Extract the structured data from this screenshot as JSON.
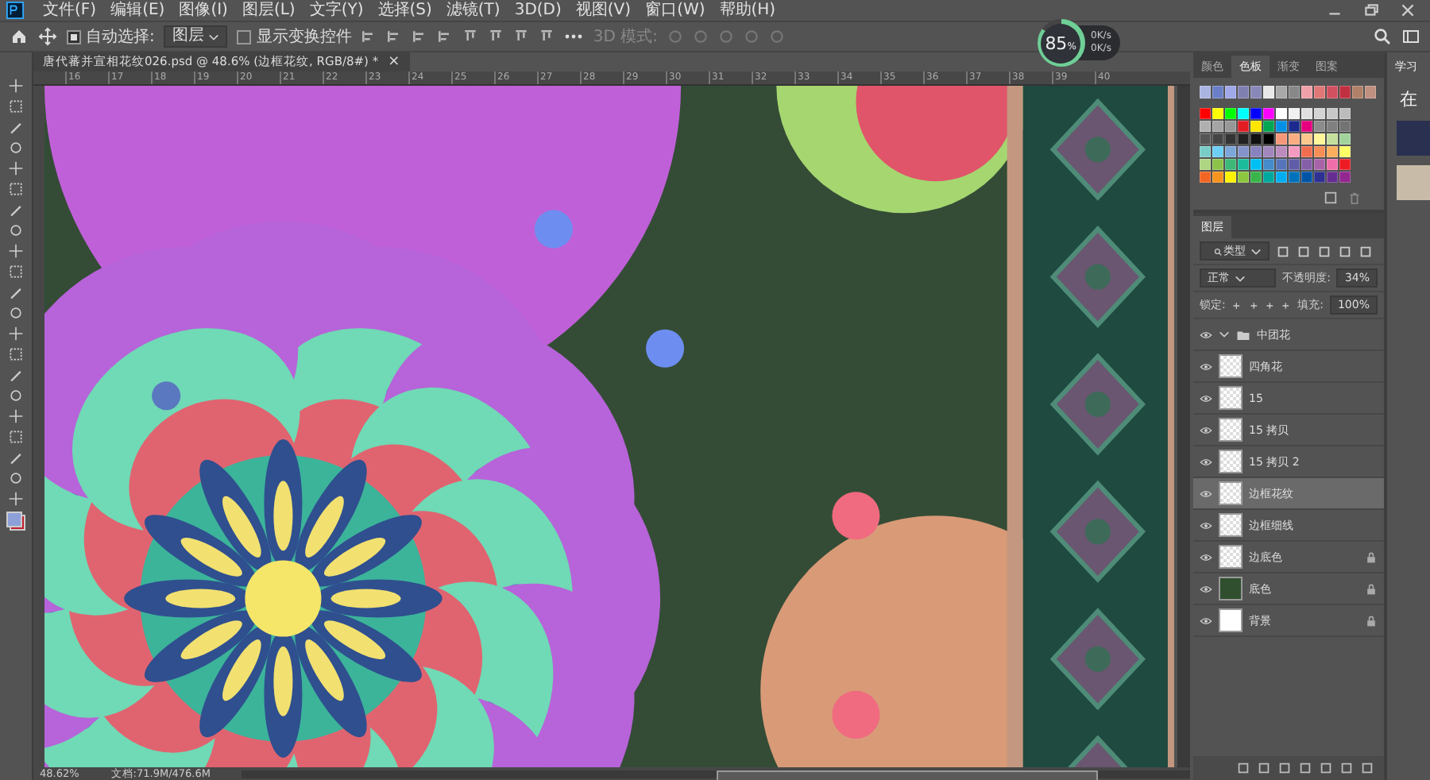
{
  "menu": [
    "文件(F)",
    "编辑(E)",
    "图像(I)",
    "图层(L)",
    "文字(Y)",
    "选择(S)",
    "滤镜(T)",
    "3D(D)",
    "视图(V)",
    "窗口(W)",
    "帮助(H)"
  ],
  "options": {
    "auto_select": {
      "label": "自动选择:",
      "checked": true
    },
    "target": "图层",
    "show_transform": {
      "label": "显示变换控件",
      "checked": false
    },
    "mode_3d": "3D 模式:"
  },
  "monitor": {
    "value": "85",
    "unit": "%",
    "up": "0K/s",
    "down": "0K/s",
    "level": 0.85
  },
  "document_tab": {
    "title": "唐代蕃并宣相花纹026.psd @ 48.6% (边框花纹, RGB/8#) *",
    "close": "×"
  },
  "ruler": [
    "16",
    "17",
    "18",
    "19",
    "20",
    "21",
    "22",
    "23",
    "24",
    "25",
    "26",
    "27",
    "28",
    "29",
    "30",
    "31",
    "32",
    "33",
    "34",
    "35",
    "36",
    "37",
    "38",
    "39",
    "40"
  ],
  "swatches_panel": {
    "tabs": [
      {
        "label": "颜色",
        "selected": false
      },
      {
        "label": "色板",
        "selected": true
      },
      {
        "label": "渐变",
        "selected": false
      },
      {
        "label": "图案",
        "selected": false
      }
    ],
    "recent": [
      {
        "color": "#aab4e0"
      },
      {
        "color": "#6b7fc8"
      },
      {
        "color": "#a0a8e8"
      },
      {
        "color": "#8080b0"
      },
      {
        "color": "#8888b8"
      },
      {
        "color": "#e8e8e8"
      },
      {
        "color": "#a8a8a8"
      },
      {
        "color": "#888888"
      },
      {
        "color": "#f0a0a8"
      },
      {
        "color": "#e07878"
      },
      {
        "color": "#d05060"
      },
      {
        "color": "#c03040"
      },
      {
        "color": "#b08068"
      },
      {
        "color": "#c09080"
      }
    ],
    "swatches": [
      {
        "color": "#ff0000"
      },
      {
        "color": "#ffff00"
      },
      {
        "color": "#00ff00"
      },
      {
        "color": "#00ffff"
      },
      {
        "color": "#0000ff"
      },
      {
        "color": "#ff00ff"
      },
      {
        "color": "#ffffff"
      },
      {
        "color": "#f0f0f0"
      },
      {
        "color": "#e0e0e0"
      },
      {
        "color": "#d4d4d4"
      },
      {
        "color": "#c8c8c8"
      },
      {
        "color": "#bcbcbc"
      },
      {
        "color": "#b0b0b0"
      },
      {
        "color": "#a4a4a4"
      },
      {
        "color": "#989898"
      },
      {
        "color": "#e31b23"
      },
      {
        "color": "#ffe600"
      },
      {
        "color": "#00a651"
      },
      {
        "color": "#0091e6"
      },
      {
        "color": "#1b2a8c"
      },
      {
        "color": "#e4007f"
      },
      {
        "color": "#8c8c8c"
      },
      {
        "color": "#808080"
      },
      {
        "color": "#737373"
      },
      {
        "color": "#555555"
      },
      {
        "color": "#444444"
      },
      {
        "color": "#333333"
      },
      {
        "color": "#222222"
      },
      {
        "color": "#111111"
      },
      {
        "color": "#000000"
      },
      {
        "color": "#f7977a"
      },
      {
        "color": "#fbad82"
      },
      {
        "color": "#fdc68c"
      },
      {
        "color": "#fff799"
      },
      {
        "color": "#c4df9b"
      },
      {
        "color": "#a3d39c"
      },
      {
        "color": "#7accc8"
      },
      {
        "color": "#6dcff6"
      },
      {
        "color": "#7da7d9"
      },
      {
        "color": "#8493ca"
      },
      {
        "color": "#8882be"
      },
      {
        "color": "#a187be"
      },
      {
        "color": "#bc8cbf"
      },
      {
        "color": "#f49ac1"
      },
      {
        "color": "#f26c4f"
      },
      {
        "color": "#f68e56"
      },
      {
        "color": "#fbaf5d"
      },
      {
        "color": "#ffff66"
      },
      {
        "color": "#aed581"
      },
      {
        "color": "#8bc34a"
      },
      {
        "color": "#3cb878"
      },
      {
        "color": "#1abc9c"
      },
      {
        "color": "#00bff3"
      },
      {
        "color": "#448ccb"
      },
      {
        "color": "#5674b9"
      },
      {
        "color": "#605ca8"
      },
      {
        "color": "#855fa8"
      },
      {
        "color": "#a863a8"
      },
      {
        "color": "#f06eaa"
      },
      {
        "color": "#ed1c24"
      },
      {
        "color": "#f26522"
      },
      {
        "color": "#f7941d"
      },
      {
        "color": "#fff200"
      },
      {
        "color": "#8dc63f"
      },
      {
        "color": "#39b54a"
      },
      {
        "color": "#00a99d"
      },
      {
        "color": "#00aeef"
      },
      {
        "color": "#0072bc"
      },
      {
        "color": "#0054a6"
      },
      {
        "color": "#2e3192"
      },
      {
        "color": "#662d91"
      },
      {
        "color": "#92278f"
      }
    ]
  },
  "learn_panel": {
    "tab": "学习",
    "text": "在"
  },
  "layers_panel": {
    "tab": "图层",
    "filter": "类型",
    "blend_mode": "正常",
    "opacity_label": "不透明度:",
    "opacity": "34%",
    "lock_label": "锁定:",
    "fill_label": "填充:",
    "fill": "100%",
    "layers": [
      {
        "kind": "group",
        "name": "中团花",
        "visible": true,
        "expanded": true,
        "selected": false,
        "locked": false
      },
      {
        "kind": "pixel",
        "name": "四角花",
        "visible": true,
        "selected": false,
        "locked": false
      },
      {
        "kind": "pixel",
        "name": "15",
        "visible": true,
        "selected": false,
        "locked": false
      },
      {
        "kind": "pixel",
        "name": "15 拷贝",
        "visible": true,
        "selected": false,
        "locked": false
      },
      {
        "kind": "pixel",
        "name": "15 拷贝 2",
        "visible": true,
        "selected": false,
        "locked": false
      },
      {
        "kind": "pixel",
        "name": "边框花纹",
        "visible": true,
        "selected": true,
        "locked": false
      },
      {
        "kind": "pixel",
        "name": "边框细线",
        "visible": true,
        "selected": false,
        "locked": false
      },
      {
        "kind": "pixel",
        "name": "边底色",
        "visible": true,
        "selected": false,
        "locked": true
      },
      {
        "kind": "fill",
        "name": "底色",
        "color": "#2f4f2f",
        "visible": true,
        "selected": false,
        "locked": true
      },
      {
        "kind": "fill",
        "name": "背景",
        "color": "#ffffff",
        "visible": true,
        "selected": false,
        "locked": true
      }
    ]
  },
  "status_bar": {
    "zoom": "48.62%",
    "document": "文档:71.9M/476.6M"
  }
}
